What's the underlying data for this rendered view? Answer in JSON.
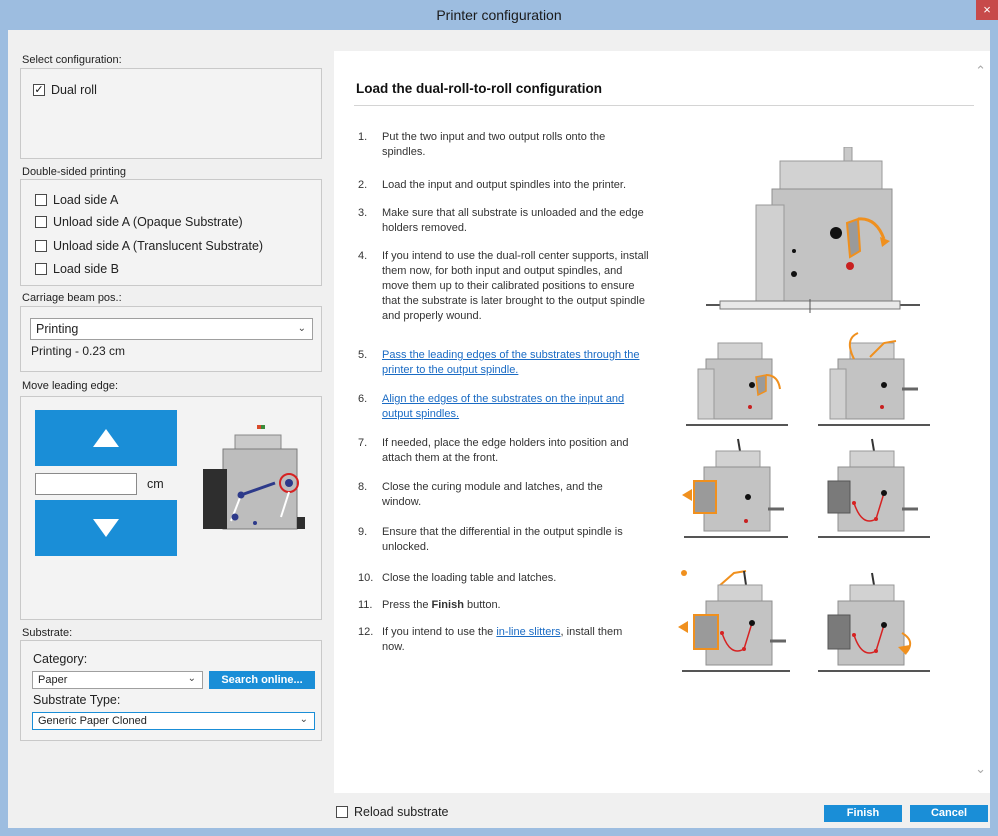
{
  "window": {
    "title": "Printer configuration",
    "close_glyph": "×"
  },
  "select_configuration": {
    "label": "Select configuration:",
    "options": [
      {
        "label": "Dual roll",
        "checked": true
      }
    ]
  },
  "double_sided": {
    "label": "Double-sided printing",
    "options": [
      {
        "label": "Load side A",
        "checked": false
      },
      {
        "label": "Unload side A (Opaque Substrate)",
        "checked": false
      },
      {
        "label": "Unload side A (Translucent Substrate)",
        "checked": false
      },
      {
        "label": "Load side B",
        "checked": false
      }
    ]
  },
  "carriage_beam": {
    "label": "Carriage beam pos.:",
    "selected": "Printing",
    "readout": "Printing - 0.23 cm"
  },
  "move_leading_edge": {
    "label": "Move leading edge:",
    "input_value": "",
    "unit": "cm",
    "up_icon": "arrow-up-icon",
    "down_icon": "arrow-down-icon"
  },
  "substrate": {
    "label": "Substrate:",
    "category_label": "Category:",
    "category_value": "Paper",
    "search_button": "Search online...",
    "type_label": "Substrate Type:",
    "type_value": "Generic Paper Cloned"
  },
  "instructions": {
    "title": "Load the dual-roll-to-roll configuration",
    "steps": [
      {
        "num": "1.",
        "text": "Put the two input and two output rolls onto the spindles."
      },
      {
        "num": "2.",
        "text": "Load the input and output spindles into the printer."
      },
      {
        "num": "3.",
        "text": "Make sure that all substrate is unloaded and the edge holders removed."
      },
      {
        "num": "4.",
        "text": "If you intend to use the dual-roll center supports, install them now, for both input and output spindles, and move them up to their calibrated positions to ensure that the substrate is later brought to the output spindle and properly wound."
      },
      {
        "num": "5.",
        "link": "Pass the leading edges of the substrates through the printer to the output spindle."
      },
      {
        "num": "6.",
        "link": "Align the edges of the substrates on the input and output spindles."
      },
      {
        "num": "7.",
        "text": "If needed, place the edge holders into position and attach them at the front."
      },
      {
        "num": "8.",
        "text": "Close the curing module and latches, and the window."
      },
      {
        "num": "9.",
        "text": "Ensure that the differential in the output spindle is unlocked."
      },
      {
        "num": "10.",
        "text": "Close the loading table and latches."
      },
      {
        "num": "11.",
        "pre": "Press the ",
        "bold": "Finish",
        "post": " button."
      },
      {
        "num": "12.",
        "pre": "If you intend to use the ",
        "link": "in-line slitters",
        "post": ", install them now."
      }
    ]
  },
  "footer": {
    "reload_label": "Reload substrate",
    "finish_button": "Finish",
    "cancel_button": "Cancel"
  },
  "colors": {
    "accent": "#1a8ed7",
    "title_bar": "#9dbde0",
    "close": "#c74a4a",
    "link": "#1a6bc4",
    "highlight_orange": "#f0901e",
    "path_red": "#d62222"
  }
}
